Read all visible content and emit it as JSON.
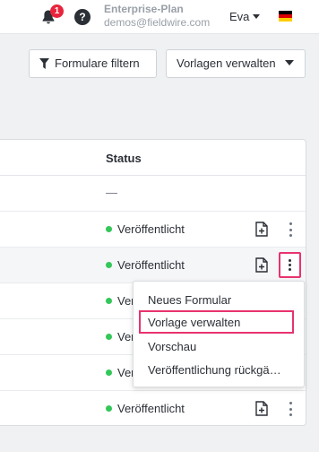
{
  "topbar": {
    "notification_count": "1",
    "help_label": "?",
    "plan": "Enterprise-Plan",
    "email": "demos@fieldwire.com",
    "user": "Eva",
    "flag_colors": [
      "#000000",
      "#dd0000",
      "#ffce00"
    ]
  },
  "toolbar": {
    "filter_label": "Formulare filtern",
    "templates_label": "Vorlagen verwalten"
  },
  "table": {
    "status_header": "Status",
    "rows": [
      {
        "status": "—"
      },
      {
        "status": "Veröffentlicht"
      },
      {
        "status": "Veröffentlicht"
      },
      {
        "status": "Ver"
      },
      {
        "status": "Ver"
      },
      {
        "status": "Ver"
      },
      {
        "status": "Veröffentlicht"
      }
    ]
  },
  "menu": {
    "items": [
      "Neues Formular",
      "Vorlage verwalten",
      "Vorschau",
      "Veröffentlichung rückgä…"
    ]
  },
  "colors": {
    "published_dot": "#34c759",
    "highlight": "#e8336e",
    "badge": "#e8243c"
  }
}
